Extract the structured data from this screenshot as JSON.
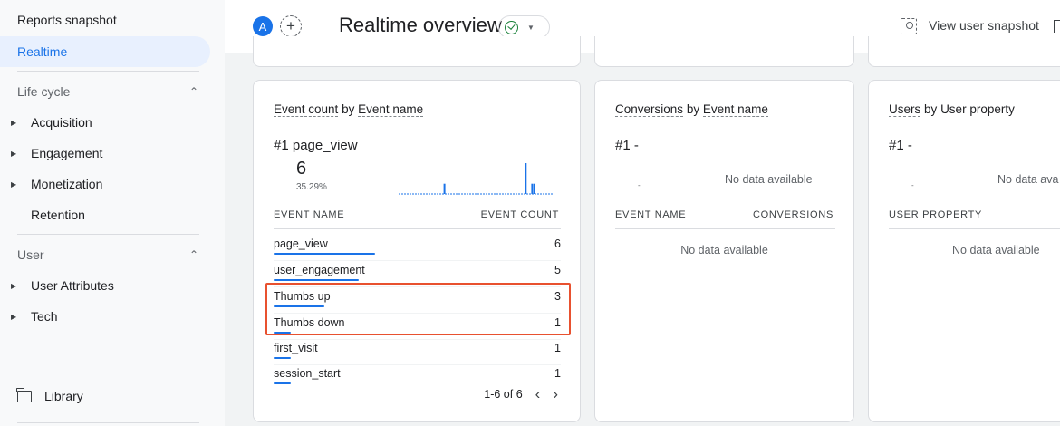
{
  "sidebar": {
    "reports_snapshot": "Reports snapshot",
    "realtime": "Realtime",
    "lifecycle": {
      "label": "Life cycle",
      "items": [
        "Acquisition",
        "Engagement",
        "Monetization",
        "Retention"
      ]
    },
    "user": {
      "label": "User",
      "items": [
        "User Attributes",
        "Tech"
      ]
    },
    "library": "Library"
  },
  "header": {
    "avatar": "A",
    "add_symbol": "+",
    "title": "Realtime overview",
    "view_snapshot": "View user snapshot"
  },
  "cards": {
    "events": {
      "title_part1": "Event count",
      "title_by": "by",
      "title_part2": "Event name",
      "top_rank": "#1",
      "top_name": "page_view",
      "top_count": "6",
      "top_pct": "35.29%",
      "col1": "EVENT NAME",
      "col2": "EVENT COUNT",
      "rows": [
        {
          "name": "page_view",
          "value": "6",
          "share": 0.3529
        },
        {
          "name": "user_engagement",
          "value": "5",
          "share": 0.2941
        },
        {
          "name": "Thumbs up",
          "value": "3",
          "share": 0.1765
        },
        {
          "name": "Thumbs down",
          "value": "1",
          "share": 0.0588
        },
        {
          "name": "first_visit",
          "value": "1",
          "share": 0.0588
        },
        {
          "name": "session_start",
          "value": "1",
          "share": 0.0588
        }
      ],
      "pager": "1-6 of 6",
      "prev": "‹",
      "next": "›",
      "sparkline": [
        0,
        0,
        0,
        0,
        0,
        0,
        0,
        0,
        0,
        0,
        0,
        0,
        0,
        0,
        0,
        0,
        0,
        0,
        0,
        0,
        0,
        2,
        0,
        0,
        0,
        0,
        0,
        0,
        0,
        0,
        0,
        0,
        0,
        0,
        0,
        0,
        0,
        0,
        0,
        0,
        0,
        0,
        0,
        0,
        0,
        0,
        0,
        0,
        0,
        0,
        0,
        0,
        0,
        0,
        0,
        0,
        0,
        0,
        0,
        6,
        0,
        0,
        2,
        2,
        0,
        0,
        0,
        0,
        0,
        0,
        0,
        0
      ],
      "highlight_color": "#e8512f"
    },
    "conversions": {
      "title_part1": "Conversions",
      "title_by": "by",
      "title_part2": "Event name",
      "top_rank": "#1",
      "top_name": "-",
      "dash": "-",
      "no_data": "No data available",
      "col1": "EVENT NAME",
      "col2": "CONVERSIONS",
      "table_no_data": "No data available"
    },
    "users": {
      "title_part1": "Users",
      "title_by": "by",
      "title_part2": "User property",
      "top_rank": "#1",
      "top_name": "-",
      "dash": "-",
      "no_data": "No data ava",
      "col1": "USER PROPERTY",
      "table_no_data": "No data available"
    }
  },
  "colors": {
    "accent": "#1a73e8",
    "success": "#188038",
    "highlight": "#e8512f"
  }
}
